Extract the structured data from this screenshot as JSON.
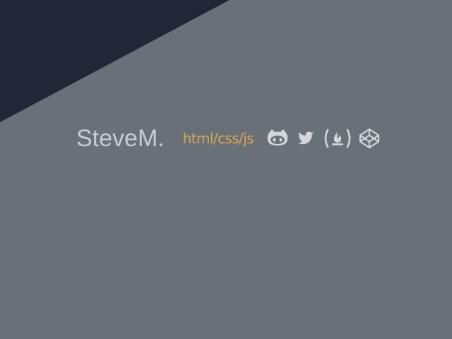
{
  "brand": {
    "name": "SteveM."
  },
  "header": {
    "tagline": "html/css/js"
  },
  "social_links": [
    {
      "icon": "github-icon",
      "network": "GitHub"
    },
    {
      "icon": "twitter-icon",
      "network": "Twitter"
    },
    {
      "icon": "freecodecamp-icon",
      "network": "freeCodeCamp"
    },
    {
      "icon": "codepen-icon",
      "network": "CodePen"
    }
  ],
  "colors": {
    "background": "#6a7078",
    "corner": "#222636",
    "brand_text": "#c7ccd2",
    "tagline": "#d8a657",
    "icons": "#d3d6da"
  }
}
